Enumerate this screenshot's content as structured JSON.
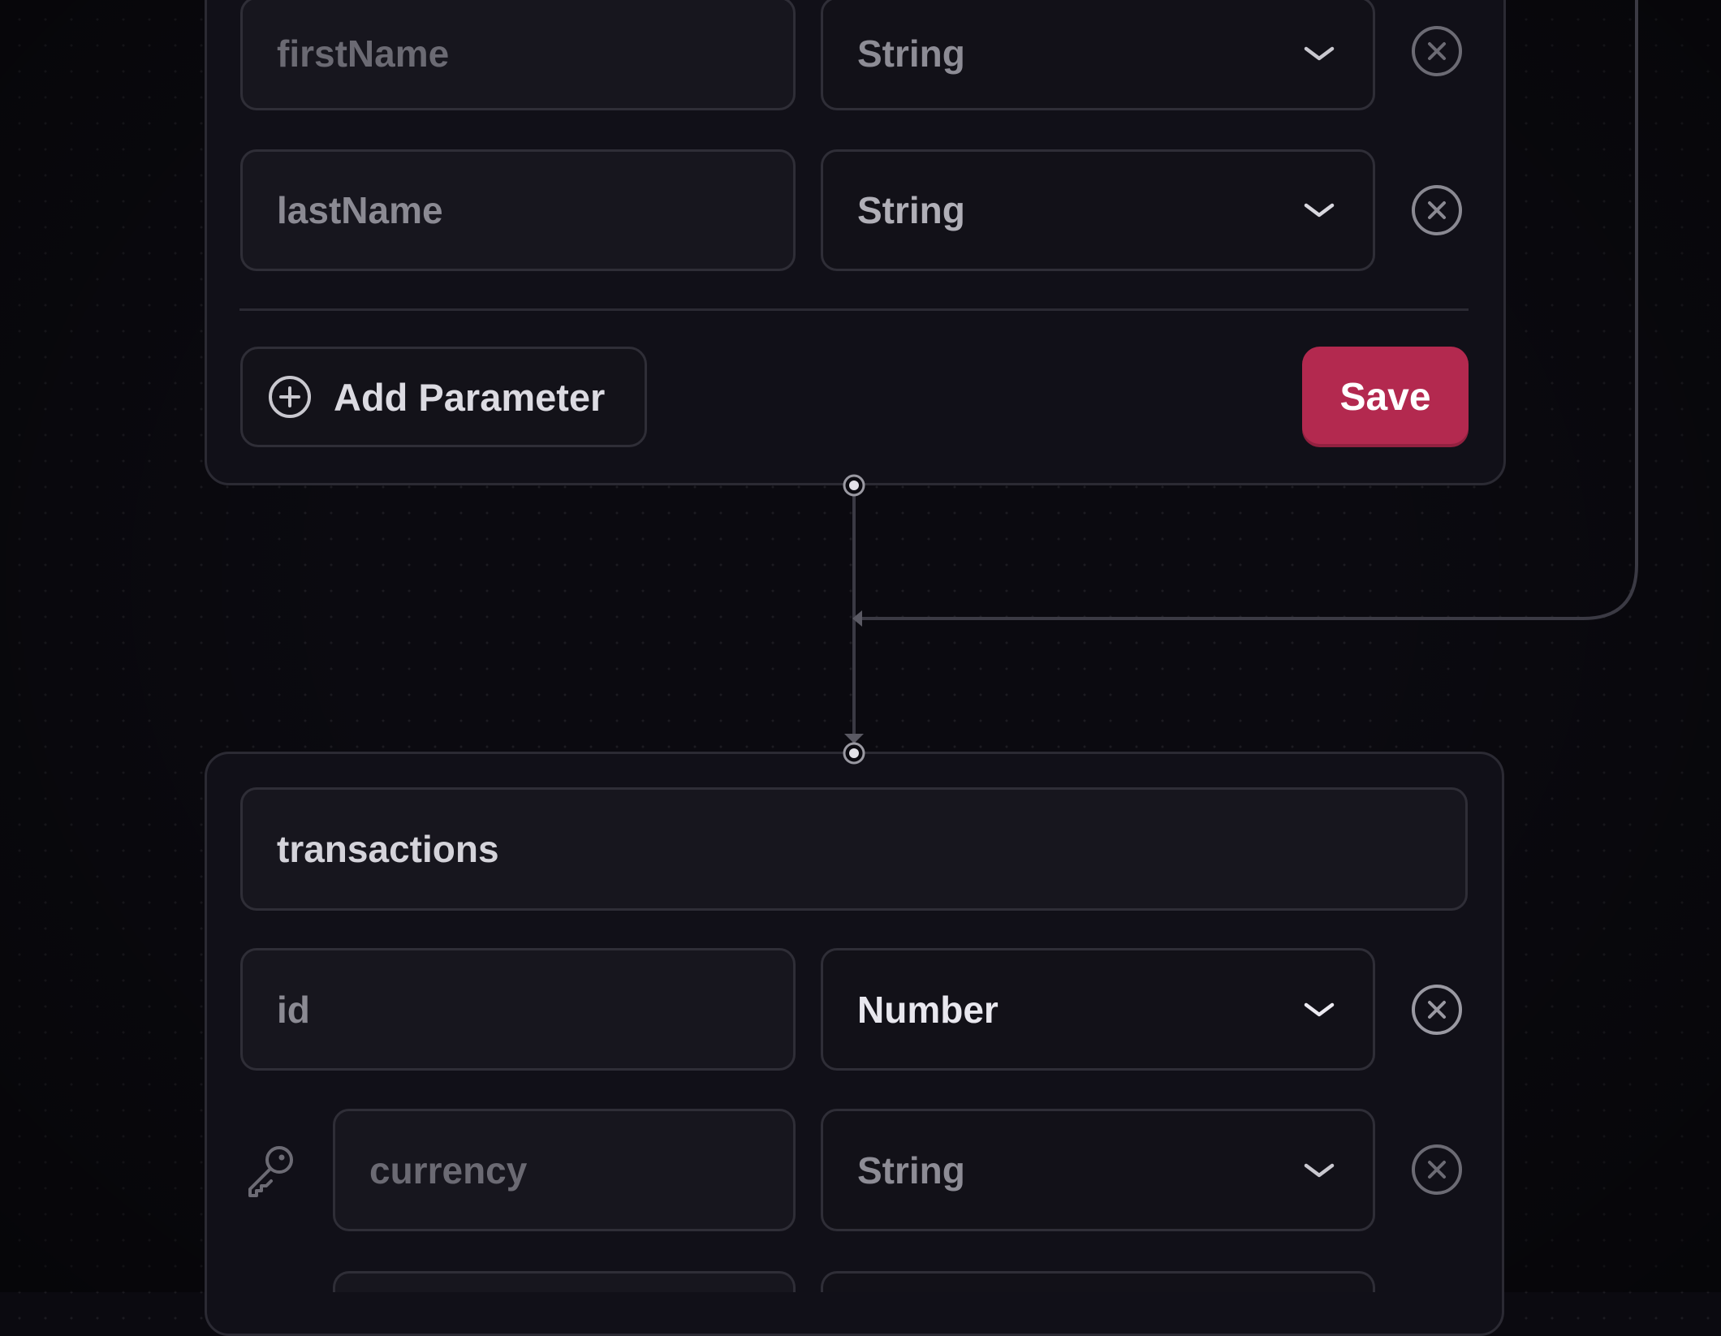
{
  "canvas": {
    "background": "#0b0a10",
    "edges": [
      "connector-edge-vertical",
      "connector-edge-loop"
    ]
  },
  "top_node": {
    "params": [
      {
        "name": "firstName",
        "type": "String",
        "remove_icon": "close-circle-icon"
      },
      {
        "name": "lastName",
        "type": "String",
        "remove_icon": "close-circle-icon"
      }
    ],
    "add_parameter_label": "Add Parameter",
    "add_parameter_icon": "plus-circle-icon",
    "save_label": "Save",
    "save_color": "#b3294f"
  },
  "bottom_node": {
    "table_name": "transactions",
    "params": [
      {
        "name": "id",
        "type": "Number",
        "remove_icon": "close-circle-icon"
      },
      {
        "name": "currency",
        "type": "String",
        "remove_icon": "close-circle-icon",
        "leading_icon": "key-icon"
      }
    ]
  },
  "select_icon": "chevron-down-icon"
}
